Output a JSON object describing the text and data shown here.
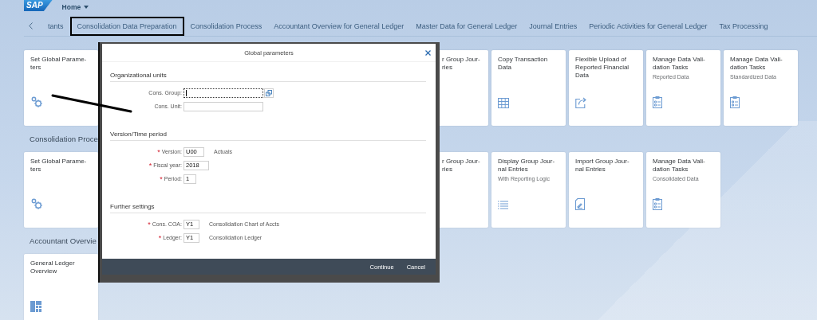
{
  "shell": {
    "logo": "SAP",
    "home": "Home"
  },
  "tabs": [
    {
      "label": "tants",
      "selected": false
    },
    {
      "label": "Consolidation Data Preparation",
      "selected": true
    },
    {
      "label": "Consolidation Process",
      "selected": false
    },
    {
      "label": "Accountant Overview for General Ledger",
      "selected": false
    },
    {
      "label": "Master Data for General Ledger",
      "selected": false
    },
    {
      "label": "Journal Entries",
      "selected": false
    },
    {
      "label": "Periodic Activities for General Ledger",
      "selected": false
    },
    {
      "label": "Tax Processing",
      "selected": false
    }
  ],
  "groups": [
    {
      "tiles": [
        {
          "kind": "settings",
          "title": "Set Global Parame-ters"
        }
      ],
      "right_tiles": [
        {
          "kind": "cut",
          "title": "r Group Jour- ries"
        },
        {
          "kind": "table",
          "title": "Copy Transaction Data"
        },
        {
          "kind": "upload",
          "title": "Flexible Upload of Reported Financial Data"
        },
        {
          "kind": "checklist",
          "title": "Manage Data Vali-dation Tasks",
          "subtitle": "Reported Data"
        },
        {
          "kind": "checklist",
          "title": "Manage Data Vali-dation Tasks",
          "subtitle": "Standardized Data"
        }
      ]
    },
    {
      "title": "Consolidation Proce",
      "tiles": [
        {
          "kind": "settings",
          "title": "Set Global Parame-ters"
        }
      ],
      "right_tiles": [
        {
          "kind": "cut",
          "title": "r Group Jour- ries"
        },
        {
          "kind": "list",
          "title": "Display Group Jour-nal Entries",
          "subtitle": "With Reporting Logic"
        },
        {
          "kind": "document",
          "title": "Import Group Jour-nal Entries"
        },
        {
          "kind": "checklist",
          "title": "Manage Data Vali-dation Tasks",
          "subtitle": "Consolidated Data"
        }
      ]
    },
    {
      "title": "Accountant Overvie",
      "tiles": [
        {
          "kind": "overview",
          "title": "General Ledger Overview"
        }
      ]
    }
  ],
  "dialog": {
    "title": "Global parameters",
    "sections": [
      {
        "title": "Organizational units",
        "fields": [
          {
            "label": "Cons. Group:",
            "kind": "long",
            "focused": true,
            "value_help": true
          },
          {
            "label": "Cons. Unit:",
            "kind": "long",
            "focused": false
          }
        ]
      },
      {
        "title": "Version/Time period",
        "fields": [
          {
            "label": "Version:",
            "required_mark": "*",
            "kind": "short",
            "value": "U00",
            "description": "Actuals",
            "focused": false
          },
          {
            "label": "Fiscal year:",
            "required_mark": "*",
            "kind": "short",
            "value": "2018",
            "focused": false
          },
          {
            "label": "Period:",
            "required_mark": "*",
            "kind": "short",
            "value": "1",
            "focused": false
          }
        ]
      },
      {
        "title": "Further settings",
        "fields": [
          {
            "label": "Cons. COA:",
            "required_mark": "*",
            "kind": "short",
            "value": "Y1",
            "description": "Consolidation Chart of Accts",
            "focused": false
          },
          {
            "label": "Ledger:",
            "required_mark": "*",
            "kind": "short",
            "value": "Y1",
            "description": "Consolidation Ledger",
            "focused": false
          }
        ]
      }
    ],
    "buttons": [
      "Continue",
      "Cancel"
    ]
  }
}
